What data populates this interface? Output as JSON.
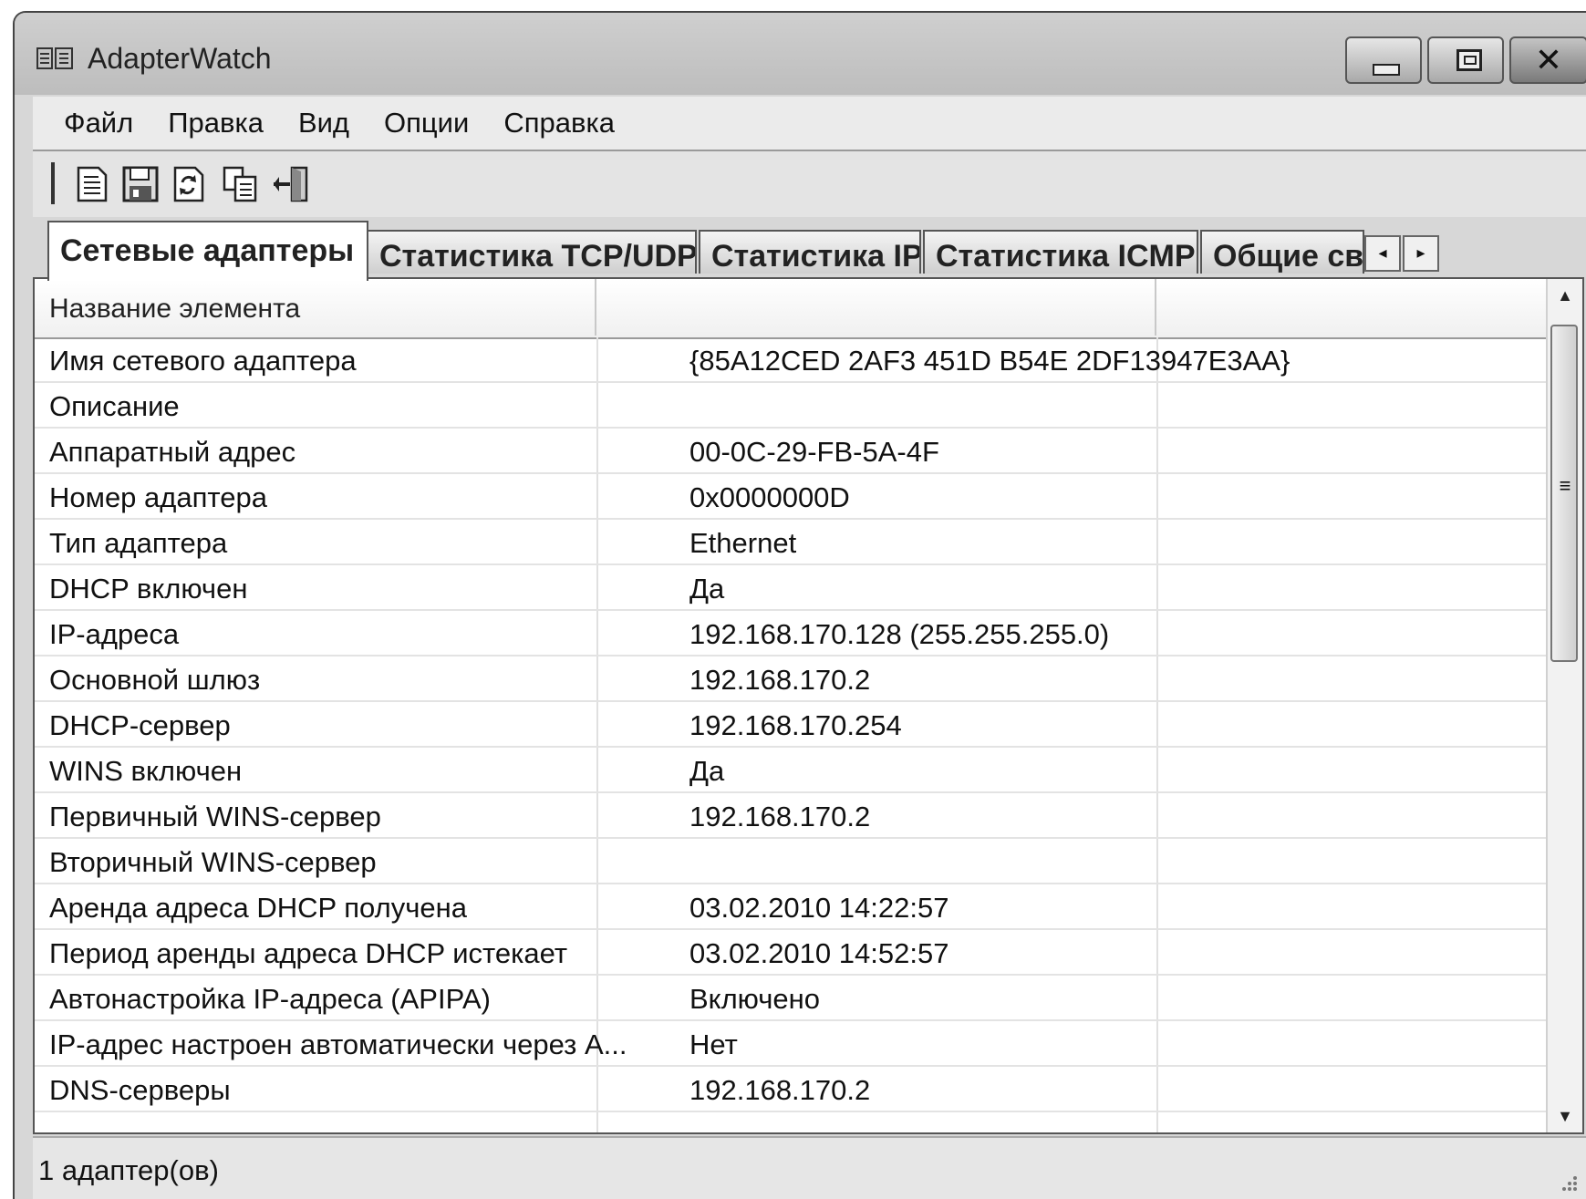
{
  "window": {
    "title": "AdapterWatch"
  },
  "menu": [
    "Файл",
    "Правка",
    "Вид",
    "Опции",
    "Справка"
  ],
  "toolbar": {
    "buttons": [
      "new-report-icon",
      "save-icon",
      "refresh-icon",
      "copy-icon",
      "exit-icon"
    ]
  },
  "tabs": [
    {
      "label": "Сетевые адаптеры",
      "active": true
    },
    {
      "label": "Статистика TCP/UDP",
      "active": false
    },
    {
      "label": "Статистика IP",
      "active": false
    },
    {
      "label": "Статистика ICMP",
      "active": false
    },
    {
      "label": "Общие св",
      "active": false
    }
  ],
  "list": {
    "header": "Название элемента",
    "rows": [
      {
        "name": "Имя сетевого адаптера",
        "value": "{85A12CED 2AF3 451D B54E 2DF13947E3AA}"
      },
      {
        "name": "Описание",
        "value": ""
      },
      {
        "name": "Аппаратный адрес",
        "value": "00-0C-29-FB-5A-4F"
      },
      {
        "name": "Номер адаптера",
        "value": "0x0000000D"
      },
      {
        "name": "Тип адаптера",
        "value": "Ethernet"
      },
      {
        "name": "DHCP включен",
        "value": "Да"
      },
      {
        "name": "IP-адреса",
        "value": "192.168.170.128 (255.255.255.0)"
      },
      {
        "name": "Основной шлюз",
        "value": "192.168.170.2"
      },
      {
        "name": "DHCP-сервер",
        "value": "192.168.170.254"
      },
      {
        "name": "WINS включен",
        "value": "Да"
      },
      {
        "name": "Первичный WINS-сервер",
        "value": "192.168.170.2"
      },
      {
        "name": "Вторичный WINS-сервер",
        "value": ""
      },
      {
        "name": "Аренда адреса DHCP получена",
        "value": "03.02.2010 14:22:57"
      },
      {
        "name": "Период аренды адреса DHCP истекает",
        "value": "03.02.2010 14:52:57"
      },
      {
        "name": "Автонастройка IP-адреса (APIPA)",
        "value": "Включено"
      },
      {
        "name": "IP-адрес настроен автоматически через А...",
        "value": "Нет"
      },
      {
        "name": "DNS-серверы",
        "value": "192.168.170.2"
      }
    ]
  },
  "status": {
    "text": "1 адаптер(ов)"
  }
}
